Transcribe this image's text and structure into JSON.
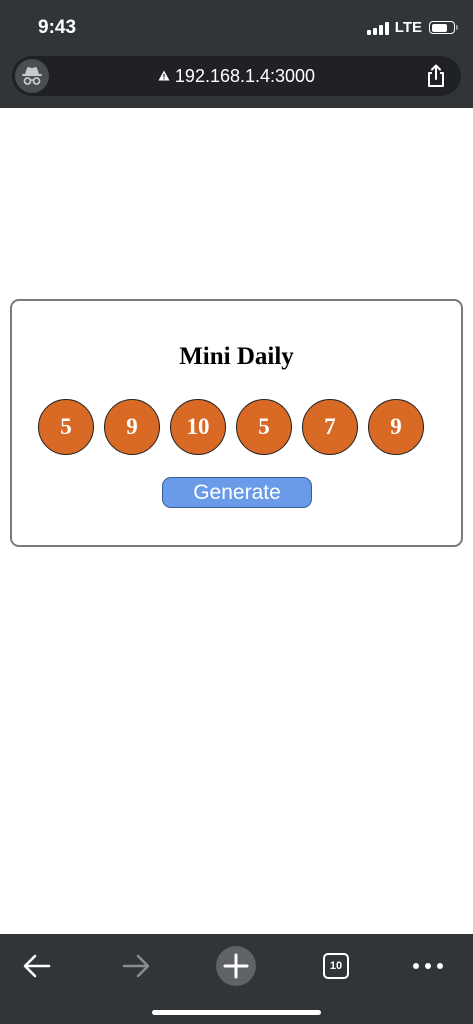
{
  "status_bar": {
    "time": "9:43",
    "network": "LTE",
    "battery_level": 0.75
  },
  "browser": {
    "url": "192.168.1.4:3000",
    "icons": {
      "incognito": "incognito-icon",
      "warning": "warning-icon",
      "share": "share-icon"
    }
  },
  "card": {
    "title": "Mini Daily",
    "numbers": [
      "5",
      "9",
      "10",
      "5",
      "7",
      "9"
    ],
    "button_label": "Generate",
    "ball_color": "#d86a26",
    "button_color": "#6a9be8"
  },
  "toolbar": {
    "tab_count": "10",
    "icons": [
      "back-icon",
      "forward-icon",
      "new-tab-icon",
      "tabs-icon",
      "more-icon"
    ]
  },
  "colors": {
    "chrome_bg": "#323538",
    "url_bar_bg": "#202124"
  }
}
